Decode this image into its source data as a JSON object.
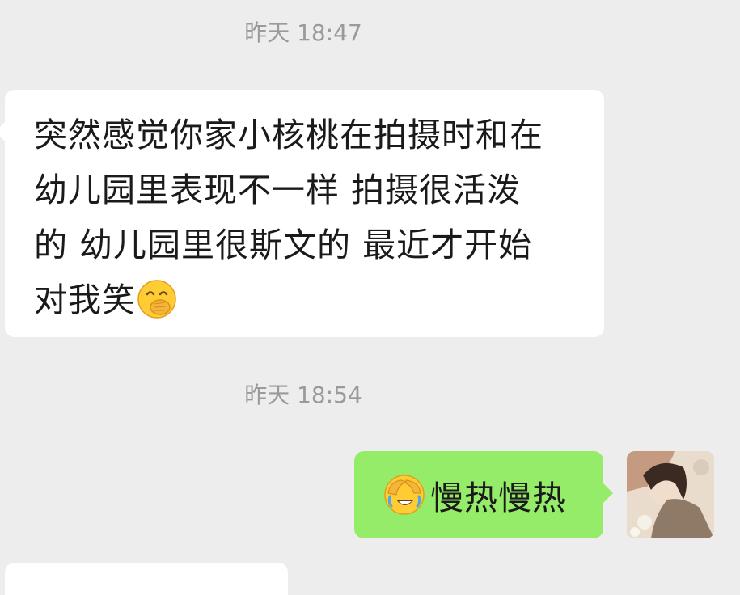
{
  "conversation": {
    "messages": [
      {
        "timestamp": "昨天 18:47",
        "direction": "incoming",
        "lines": [
          "突然感觉你家小核桃在拍摄时和在",
          "幼儿园里表现不一样 拍摄很活泼",
          "的 幼儿园里很斯文的 最近才开始",
          "对我笑"
        ],
        "emoji": "hand-over-mouth-face"
      },
      {
        "timestamp": "昨天 18:54",
        "direction": "outgoing",
        "emoji": "face-palm-face",
        "text": "慢热慢热"
      }
    ]
  },
  "colors": {
    "background": "#ededed",
    "incoming_bubble": "#ffffff",
    "outgoing_bubble": "#95ec69",
    "timestamp_text": "#9a9a9a",
    "message_text": "#1a1a1a"
  },
  "icons": {
    "avatar": "user-avatar-photo"
  }
}
